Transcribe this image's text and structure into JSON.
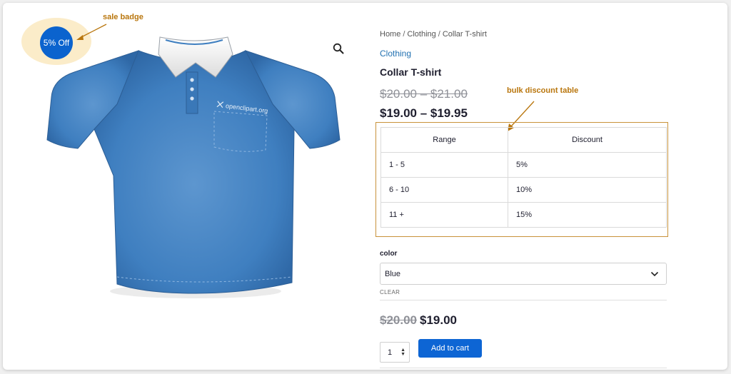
{
  "badge": {
    "label": "5% Off"
  },
  "annotations": {
    "sale": "sale badge",
    "bulk": "bulk discount table"
  },
  "shirt": {
    "pocket_logo": "openclipart.org"
  },
  "breadcrumb": {
    "items": [
      "Home",
      "Clothing",
      "Collar T-shirt"
    ],
    "separator": "/"
  },
  "category": "Clothing",
  "product": {
    "title": "Collar T-shirt",
    "regular_range": "$20.00 – $21.00",
    "sale_range": "$19.00 – $19.95"
  },
  "bulk_table": {
    "headers": [
      "Range",
      "Discount"
    ],
    "rows": [
      [
        "1 - 5",
        "5%"
      ],
      [
        "6 - 10",
        "10%"
      ],
      [
        "11 +",
        "15%"
      ]
    ]
  },
  "variation": {
    "label": "color",
    "selected": "Blue",
    "clear_label": "CLEAR"
  },
  "price": {
    "regular": "$20.00",
    "sale": "$19.00"
  },
  "cart": {
    "quantity": "1",
    "button_label": "Add to cart"
  },
  "colors": {
    "badge": "#0b63ce",
    "annotation": "#b9760d",
    "button": "#0d65d4",
    "shirt": "#3f7fc0"
  },
  "icons": {
    "zoom": "search-icon",
    "select": "chevron-down-icon"
  }
}
